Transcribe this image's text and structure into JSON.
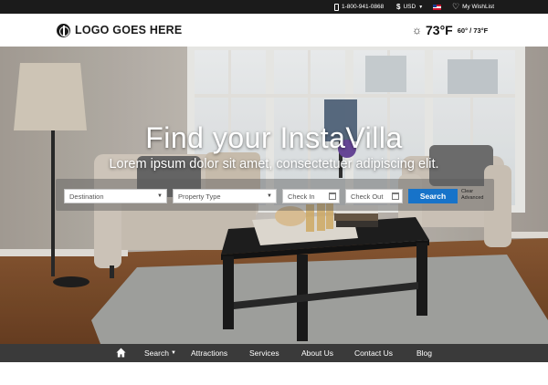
{
  "topbar": {
    "phone": "1-800-941-0868",
    "currency": "USD",
    "wishlist": "My WishList",
    "icons": [
      "phone-icon",
      "dollar-icon",
      "caret-down-icon",
      "flag-icon",
      "heart-icon"
    ]
  },
  "header": {
    "logo_text": "LOGO GOES HERE",
    "weather": {
      "temp": "73°F",
      "range": "60° / 73°F",
      "icon": "sun-icon"
    }
  },
  "hero": {
    "title": "Find your InstaVilla",
    "subtitle": "Lorem ipsum dolor sit amet, consectetuer adipiscing elit."
  },
  "search": {
    "destination": "Destination",
    "property_type": "Property Type",
    "check_in": "Check In",
    "check_out": "Check Out",
    "button": "Search",
    "clear": "Clear",
    "advanced": "Advanced"
  },
  "nav": {
    "home_icon": "home-icon",
    "items": [
      "Search",
      "Attractions",
      "Services",
      "About Us",
      "Contact Us",
      "Blog"
    ]
  },
  "colors": {
    "topbar_bg": "#1b1b1b",
    "nav_bg": "#3a3a3a",
    "accent": "#1773c9"
  }
}
